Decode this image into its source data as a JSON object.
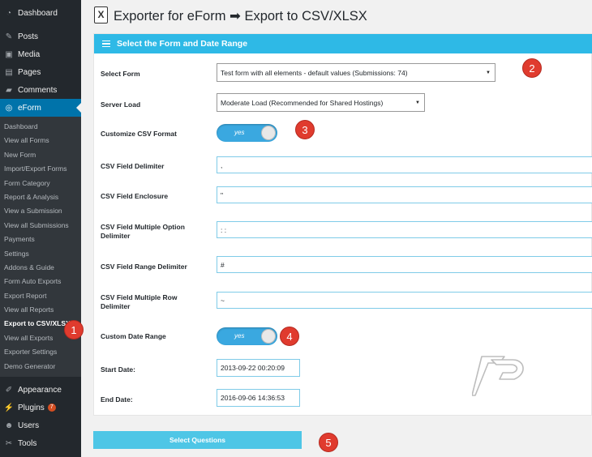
{
  "sidebar": {
    "top_items": [
      {
        "label": "Dashboard",
        "icon": "dashboard-icon"
      },
      {
        "label": "Posts",
        "icon": "pin-icon"
      },
      {
        "label": "Media",
        "icon": "media-icon"
      },
      {
        "label": "Pages",
        "icon": "pages-icon"
      },
      {
        "label": "Comments",
        "icon": "comments-icon"
      },
      {
        "label": "eForm",
        "icon": "eform-icon"
      }
    ],
    "submenu": [
      "Dashboard",
      "View all Forms",
      "New Form",
      "Import/Export Forms",
      "Form Category",
      "Report & Analysis",
      "View a Submission",
      "View all Submissions",
      "Payments",
      "Settings",
      "Addons & Guide",
      "Form Auto Exports",
      "Export Report",
      "View all Reports",
      "Export to CSV/XLSX",
      "View all Exports",
      "Exporter Settings",
      "Demo Generator"
    ],
    "bottom_items": [
      {
        "label": "Appearance",
        "icon": "brush-icon"
      },
      {
        "label": "Plugins",
        "icon": "plug-icon",
        "badge": "7"
      },
      {
        "label": "Users",
        "icon": "users-icon"
      },
      {
        "label": "Tools",
        "icon": "wrench-icon"
      }
    ]
  },
  "header": {
    "icon_glyph": "X",
    "title": "Exporter for eForm ➡ Export to CSV/XLSX"
  },
  "panel": {
    "heading": "Select the Form and Date Range",
    "rows": {
      "select_form": {
        "label": "Select Form",
        "value": "Test form with all elements - default values (Submissions: 74)"
      },
      "server_load": {
        "label": "Server Load",
        "value": "Moderate Load (Recommended for Shared Hostings)"
      },
      "customize_csv": {
        "label": "Customize CSV Format",
        "toggle": "yes"
      },
      "csv_delimiter": {
        "label": "CSV Field Delimiter",
        "value": ","
      },
      "csv_enclosure": {
        "label": "CSV Field Enclosure",
        "value": "\""
      },
      "csv_multi_option": {
        "label1": "CSV Field Multiple Option",
        "label2": "Delimiter",
        "value": ": :"
      },
      "csv_range": {
        "label": "CSV Field Range Delimiter",
        "value": "#"
      },
      "csv_multi_row": {
        "label1": "CSV Field Multiple Row",
        "label2": "Delimiter",
        "value": "~"
      },
      "custom_date": {
        "label": "Custom Date Range",
        "toggle": "yes"
      },
      "start_date": {
        "label": "Start Date:",
        "value": "2013-09-22 00:20:09"
      },
      "end_date": {
        "label": "End Date:",
        "value": "2016-09-06 14:36:53"
      }
    }
  },
  "button": {
    "select_questions": "Select Questions"
  },
  "markers": [
    "1",
    "2",
    "3",
    "4",
    "5"
  ],
  "colors": {
    "accent": "#2eb9e6",
    "sidebar": "#23282d",
    "marker": "#e03b2e",
    "current": "#0073aa"
  }
}
